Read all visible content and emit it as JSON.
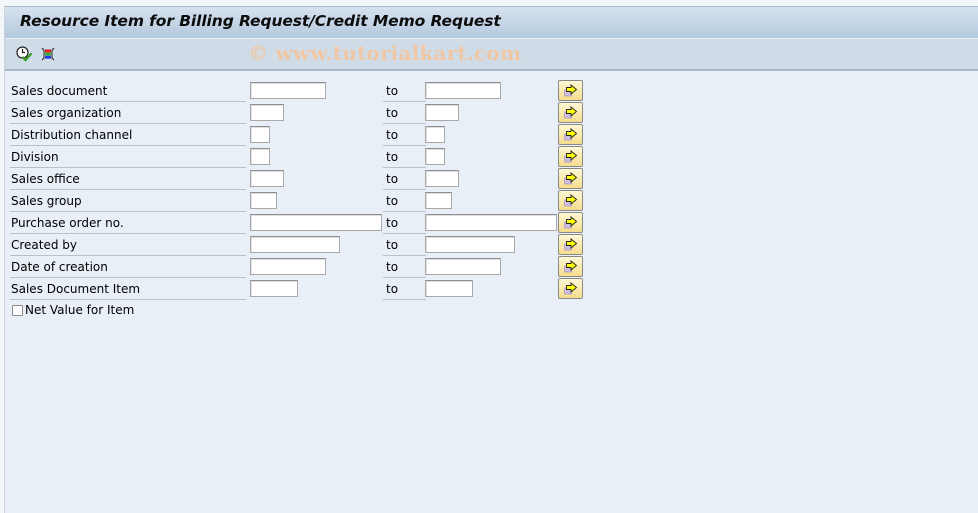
{
  "window": {
    "title": "Resource Item for Billing Request/Credit Memo Request"
  },
  "toolbar": {
    "items": [
      {
        "name": "execute-icon",
        "tooltip": "Execute"
      },
      {
        "name": "selection-options-icon",
        "tooltip": "Selection options"
      }
    ],
    "watermark": "© www.tutorialkart.com"
  },
  "selection": {
    "to_label": "to",
    "rows": [
      {
        "label": "Sales document",
        "low": "",
        "high": ""
      },
      {
        "label": "Sales organization",
        "low": "",
        "high": ""
      },
      {
        "label": "Distribution channel",
        "low": "",
        "high": ""
      },
      {
        "label": "Division",
        "low": "",
        "high": ""
      },
      {
        "label": "Sales office",
        "low": "",
        "high": ""
      },
      {
        "label": "Sales group",
        "low": "",
        "high": ""
      },
      {
        "label": "Purchase order no.",
        "low": "",
        "high": ""
      },
      {
        "label": "Created by",
        "low": "",
        "high": ""
      },
      {
        "label": "Date of creation",
        "low": "",
        "high": ""
      },
      {
        "label": "Sales Document Item",
        "low": "",
        "high": ""
      }
    ],
    "checkbox": {
      "label": "Net Value for Item",
      "checked": false
    }
  },
  "colors": {
    "background": "#e8eff7",
    "title_bar": "#c4d5e6",
    "toolbar": "#cfdce8",
    "multi_select_button": "#f9e8a8",
    "arrow": "#ffff00"
  }
}
